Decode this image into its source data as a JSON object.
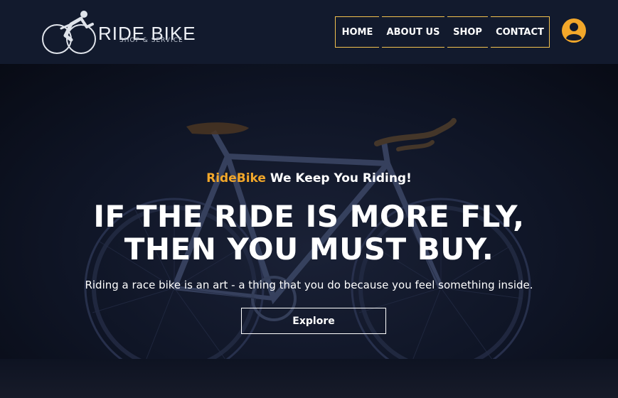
{
  "header": {
    "logo": {
      "title": "RIDE BIKE",
      "subtitle": "SHOP & SERVICE",
      "icon": "cyclist-logo-icon"
    },
    "nav": [
      {
        "label": "HOME"
      },
      {
        "label": "ABOUT US"
      },
      {
        "label": "SHOP"
      },
      {
        "label": "CONTACT"
      }
    ],
    "user_icon": "user-account-icon"
  },
  "hero": {
    "tagline_brand": "RideBike",
    "tagline_rest": " We Keep You Riding!",
    "headline_line1": "IF THE RIDE IS MORE FLY,",
    "headline_line2": "THEN YOU MUST BUY.",
    "subtext": "Riding a race bike is an art - a thing that you do because you feel something inside.",
    "cta_label": "Explore",
    "background_icon": "bicycle-image"
  },
  "colors": {
    "header_bg": "#121a2d",
    "accent": "#f2a72a",
    "nav_border": "#f2c14e",
    "text": "#ffffff"
  }
}
